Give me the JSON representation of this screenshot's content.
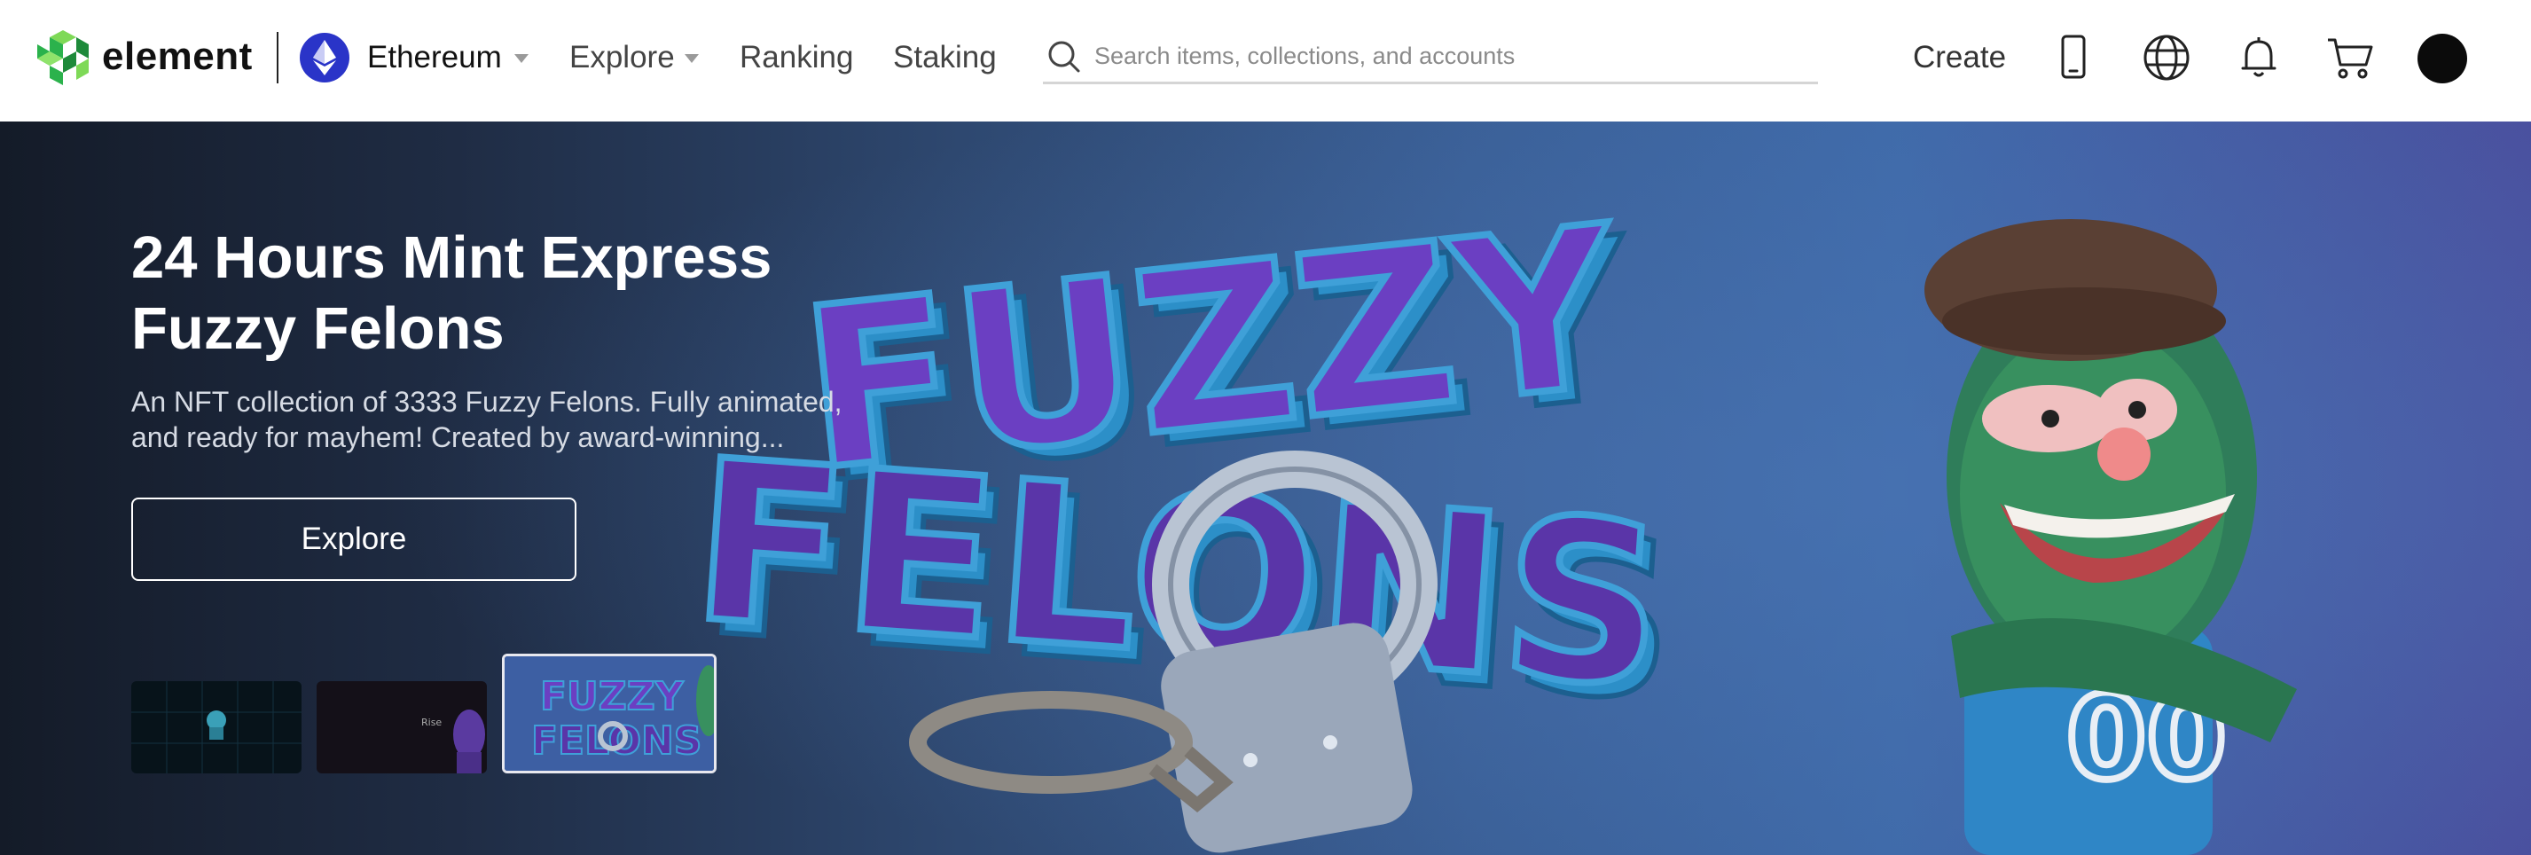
{
  "header": {
    "logo_text": "element",
    "chain": "Ethereum",
    "nav": [
      {
        "label": "Explore"
      },
      {
        "label": "Ranking"
      },
      {
        "label": "Staking"
      }
    ],
    "search_placeholder": "Search items, collections, and accounts",
    "create_label": "Create",
    "icons": [
      "mobile-icon",
      "globe-icon",
      "bell-icon",
      "cart-icon",
      "avatar"
    ]
  },
  "hero": {
    "title_line1": "24 Hours Mint Express",
    "title_line2": "Fuzzy Felons",
    "description_line1": "An NFT collection of 3333 Fuzzy Felons. Fully animated,",
    "description_line2": "and ready for mayhem! Created by award-winning...",
    "button_label": "Explore",
    "artwork_text_line1": "FUZZY",
    "artwork_text_line2": "FELONS",
    "thumbnail_text": "FUZZY FELONS",
    "thumbnails": [
      {
        "name": "dark-grid-thumb",
        "selected": false
      },
      {
        "name": "purple-character-thumb",
        "selected": false
      },
      {
        "name": "fuzzy-felons-thumb",
        "selected": true
      }
    ]
  },
  "colors": {
    "brand_green": "#2bb24c",
    "chain_blue": "#2a34c8",
    "hero_dark": "#141b28",
    "hero_blue": "#3f6aa9",
    "title_purple": "#6b3fc2"
  }
}
